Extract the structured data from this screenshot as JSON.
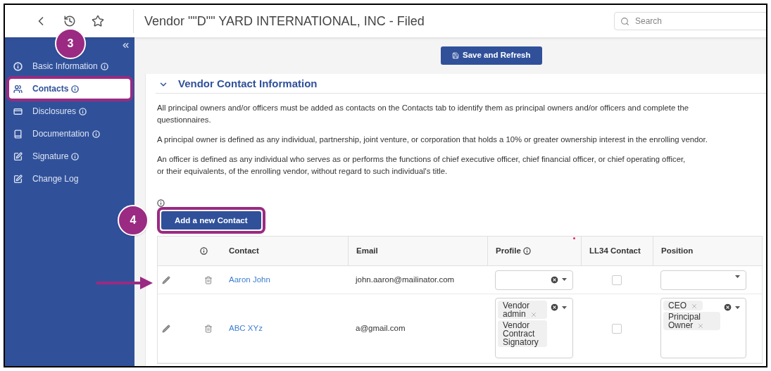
{
  "header": {
    "title": "Vendor \"\"D\"\" YARD INTERNATIONAL, INC - Filed",
    "search": {
      "placeholder": "Search"
    }
  },
  "sidebar": {
    "items": [
      {
        "label": "Basic Information",
        "kind": "info",
        "info": true,
        "selected": false
      },
      {
        "label": "Contacts",
        "kind": "users",
        "info": true,
        "selected": true
      },
      {
        "label": "Disclosures",
        "kind": "card",
        "info": true,
        "selected": false
      },
      {
        "label": "Documentation",
        "kind": "book",
        "info": true,
        "selected": false
      },
      {
        "label": "Signature",
        "kind": "edit",
        "info": true,
        "selected": false
      },
      {
        "label": "Change Log",
        "kind": "edit",
        "info": false,
        "selected": false
      }
    ]
  },
  "toolbar": {
    "save_button": "Save and Refresh"
  },
  "section": {
    "title": "Vendor Contact Information",
    "expanded": true,
    "paragraphs": [
      {
        "lines": [
          "All principal owners and/or officers must be added as contacts on the Contacts tab to identify them as principal owners and/or officers and complete the",
          "questionnaires."
        ]
      },
      {
        "lines": [
          "A principal owner is defined as any individual, partnership, joint venture, or corporation that holds a 10% or greater ownership interest in the enrolling vendor."
        ]
      },
      {
        "lines": [
          "An officer is defined as any individual who serves as or performs the functions of chief executive officer, chief financial officer, or chief operating officer,",
          "or their equivalents, of the enrolling vendor, without regard to such individual's title."
        ]
      }
    ],
    "add_button": "Add a new Contact"
  },
  "table": {
    "columns": [
      {
        "label": "Contact",
        "info": false,
        "required": false
      },
      {
        "label": "Email",
        "info": false,
        "required": false
      },
      {
        "label": "Profile",
        "info": true,
        "required": true
      },
      {
        "label": "LL34 Contact",
        "info": false,
        "required": false
      },
      {
        "label": "Position",
        "info": false,
        "required": false
      }
    ],
    "rows": [
      {
        "contact": "Aaron John",
        "email": "john.aaron@mailinator.com",
        "profile": {
          "clear_button": true
        },
        "ll34_checked": false,
        "position": {
          "clear_button": false
        }
      },
      {
        "contact": "ABC XYz",
        "email": "a@gmail.com",
        "profile": {
          "clear_button": true,
          "tags": [
            {
              "label": "Vendor admin",
              "removable": true
            },
            {
              "label": "Vendor Contract Signatory",
              "removable": false
            }
          ]
        },
        "ll34_checked": false,
        "position": {
          "clear_button": true,
          "tags": [
            {
              "label": "CEO",
              "removable": true
            },
            {
              "label": "Principal Owner",
              "removable": true
            }
          ]
        }
      }
    ]
  },
  "callouts": [
    {
      "label": "3"
    },
    {
      "label": "4"
    }
  ]
}
